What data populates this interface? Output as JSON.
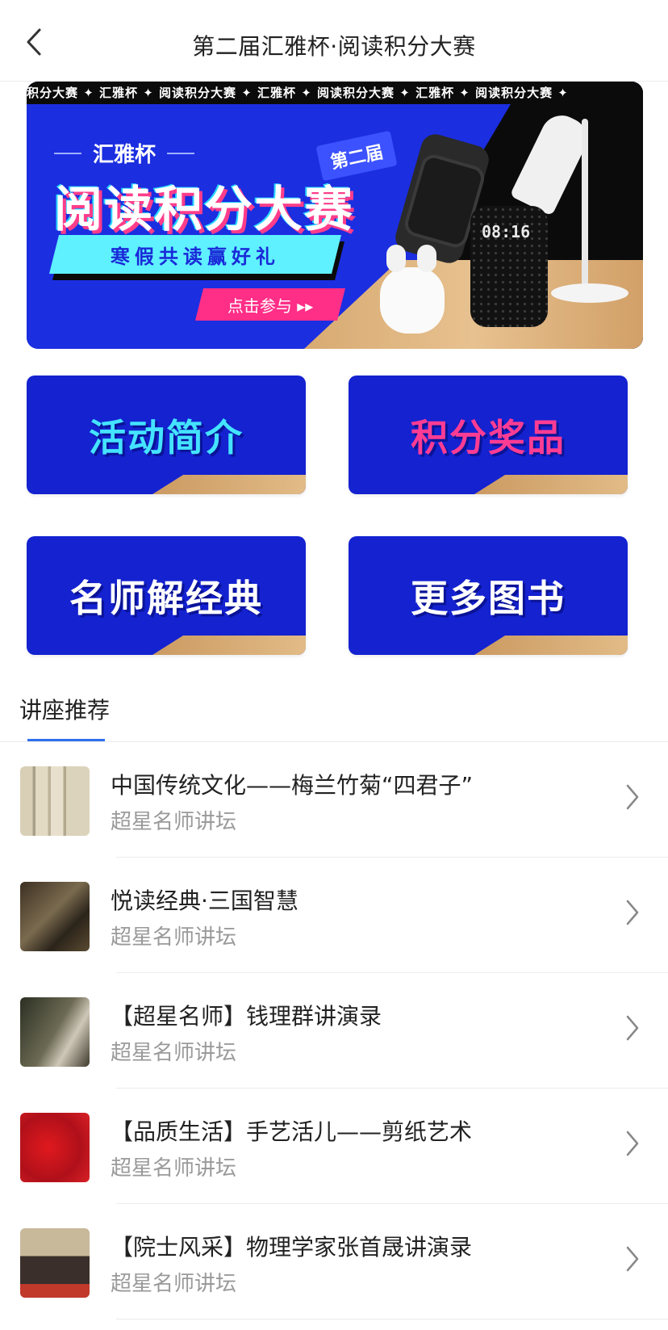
{
  "header": {
    "title": "第二届汇雅杯·阅读积分大赛",
    "back_icon": "chevron-left-icon"
  },
  "banner": {
    "ticker_text": "积分大赛 ✦ 汇雅杯 ✦ 阅读积分大赛 ✦ 汇雅杯 ✦ 阅读积分大赛 ✦ 汇雅杯 ✦ 阅读积分大赛 ✦",
    "brand": "汇雅杯",
    "edition": "第二届",
    "main_title": "阅读积分大赛",
    "slogan": "寒假共读赢好礼",
    "cta": "点击参与 ▸▸",
    "speaker_time": "08:16"
  },
  "tiles": [
    {
      "label": "活动简介"
    },
    {
      "label": "积分奖品"
    },
    {
      "label": "名师解经典"
    },
    {
      "label": "更多图书"
    }
  ],
  "section": {
    "title": "讲座推荐"
  },
  "lectures": [
    {
      "title": "中国传统文化——梅兰竹菊“四君子”",
      "subtitle": "超星名师讲坛"
    },
    {
      "title": "悦读经典·三国智慧",
      "subtitle": "超星名师讲坛"
    },
    {
      "title": "【超星名师】钱理群讲演录",
      "subtitle": "超星名师讲坛"
    },
    {
      "title": "【品质生活】手艺活儿——剪纸艺术",
      "subtitle": "超星名师讲坛"
    },
    {
      "title": "【院士风采】物理学家张首晟讲演录",
      "subtitle": "超星名师讲坛"
    }
  ],
  "colors": {
    "accent_blue": "#2f6ff0",
    "banner_blue": "#1a2ad8",
    "tile_blue": "#1422d0",
    "pink": "#ff2e87",
    "cyan": "#44e3ff"
  }
}
